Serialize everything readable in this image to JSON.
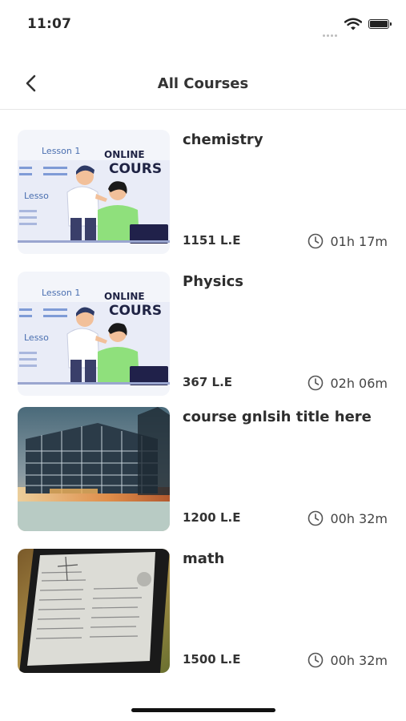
{
  "status_bar": {
    "time": "11:07"
  },
  "header": {
    "title": "All Courses"
  },
  "courses": [
    {
      "title": "chemistry",
      "price": "1151 L.E",
      "duration": "01h 17m",
      "thumb_lesson": "Lesson 1",
      "thumb_lesson2": "Lesso",
      "thumb_online": "ONLINE",
      "thumb_course": "COURS"
    },
    {
      "title": "Physics",
      "price": "367 L.E",
      "duration": "02h 06m",
      "thumb_lesson": "Lesson 1",
      "thumb_lesson2": "Lesso",
      "thumb_online": "ONLINE",
      "thumb_course": "COURS"
    },
    {
      "title": "course gnlsih title here",
      "price": "1200 L.E",
      "duration": "00h 32m"
    },
    {
      "title": "math",
      "price": "1500 L.E",
      "duration": "00h 32m"
    }
  ],
  "icons": {
    "back": "chevron-left-icon",
    "clock": "clock-icon",
    "wifi": "wifi-icon",
    "battery": "battery-icon",
    "signal": "signal-icon"
  }
}
